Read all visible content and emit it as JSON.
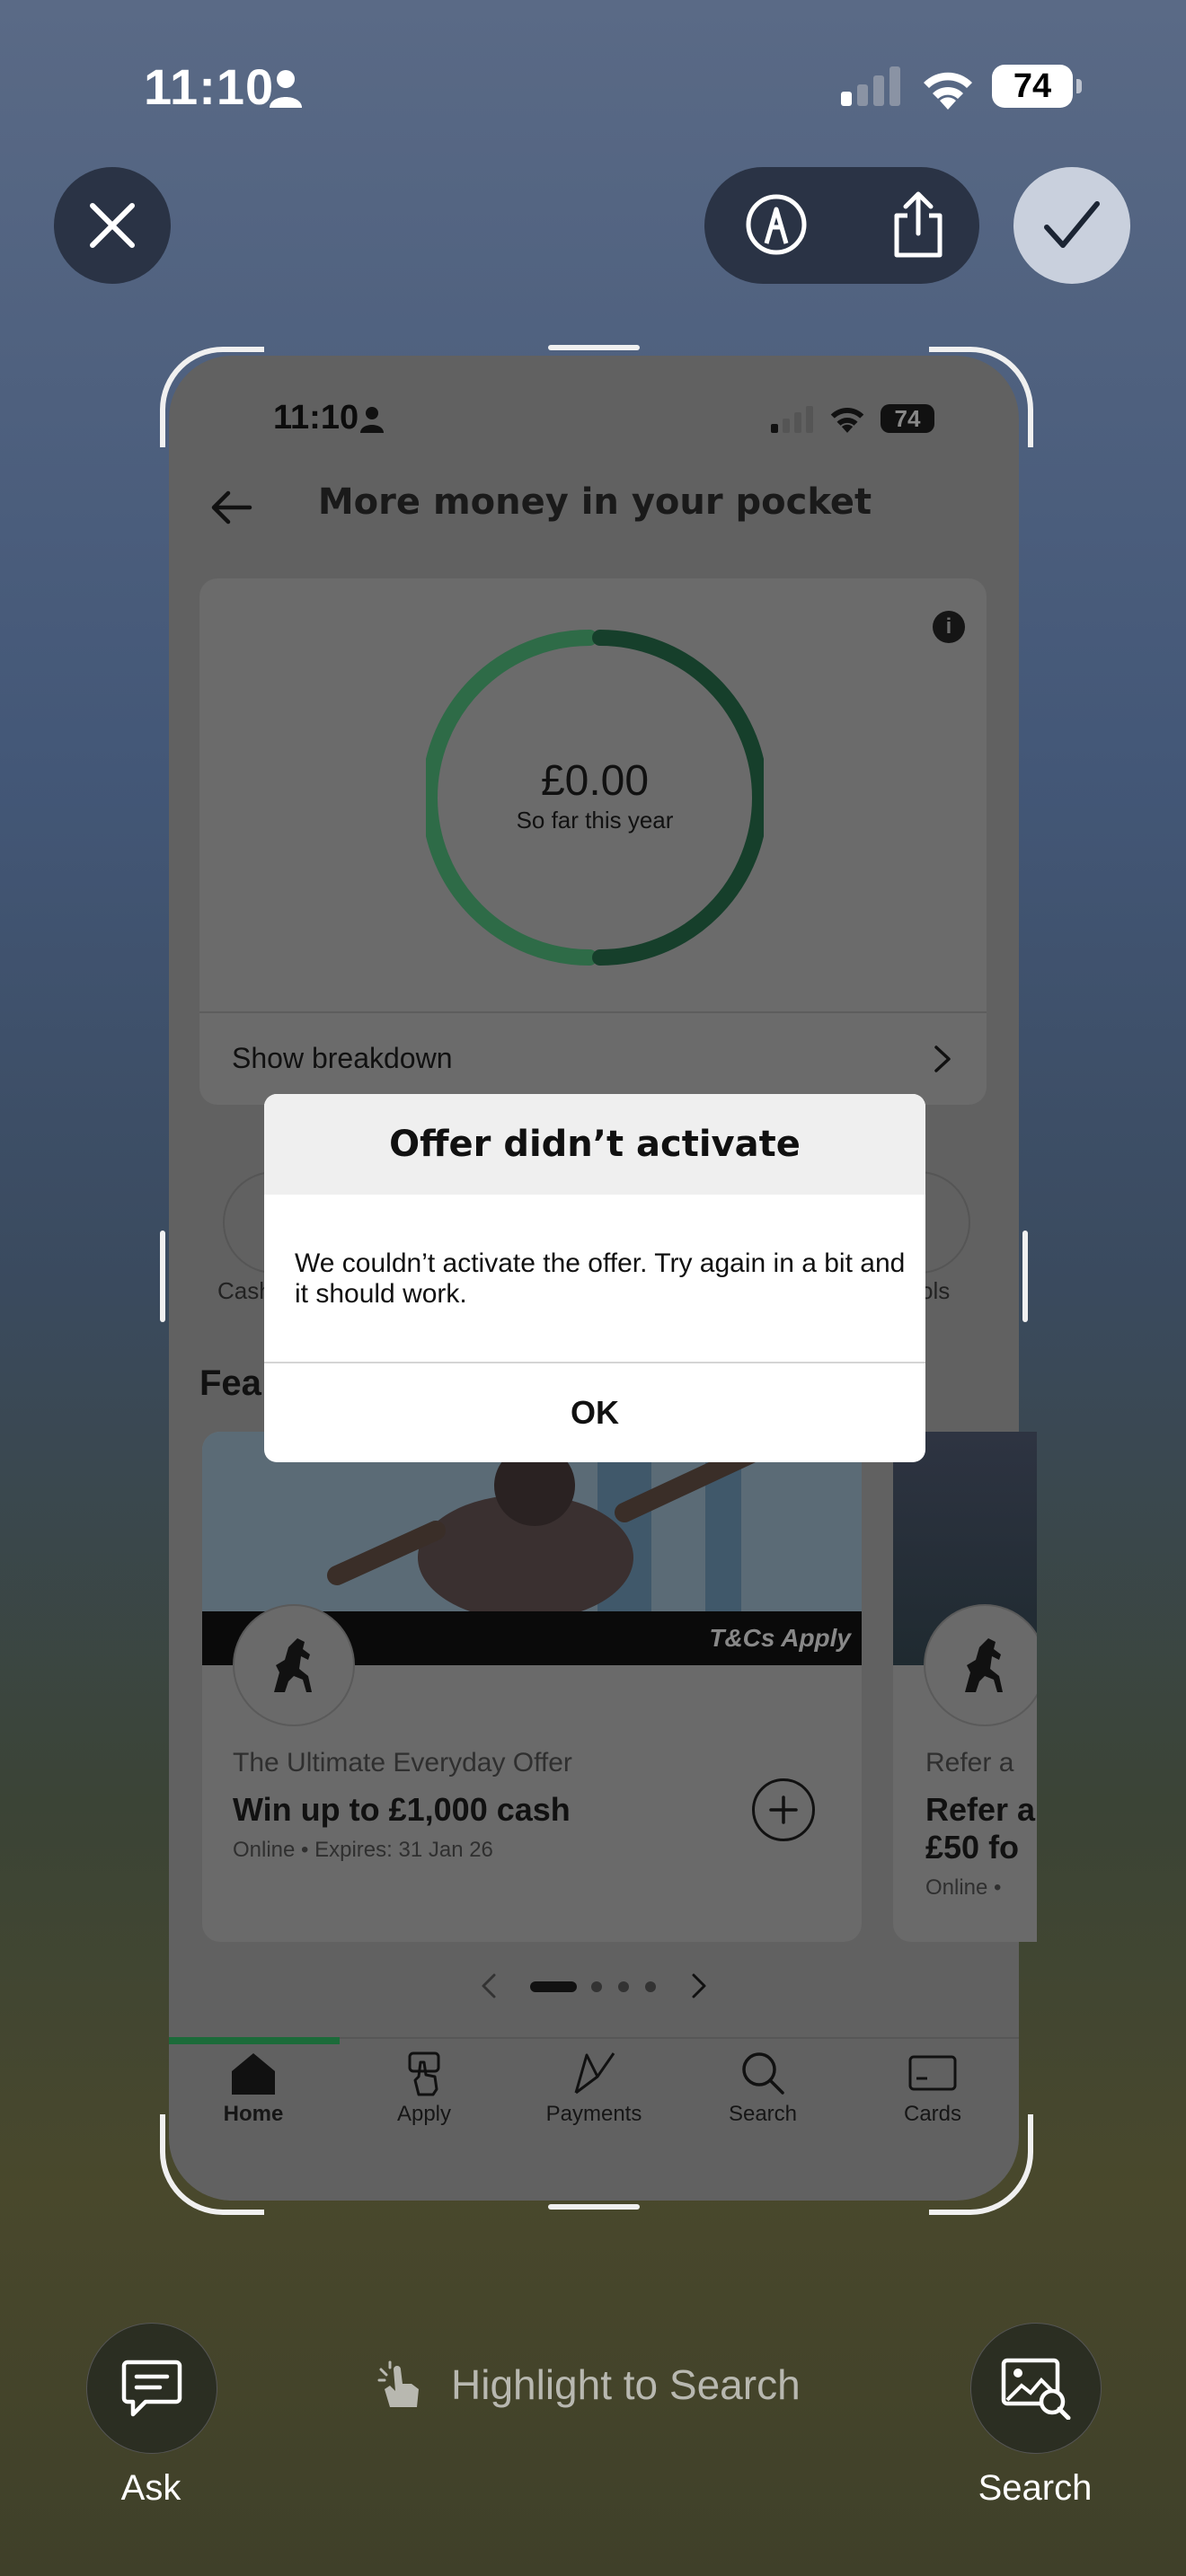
{
  "os_status": {
    "time": "11:10",
    "battery": "74"
  },
  "toolbar": {
    "close": "close",
    "markup": "markup",
    "share": "share",
    "done": "done"
  },
  "screen": {
    "status": {
      "time": "11:10",
      "battery": "74"
    },
    "header": {
      "title": "More money in your pocket"
    },
    "summary": {
      "amount": "£0.00",
      "amount_label": "So far this year",
      "breakdown_label": "Show breakdown",
      "ring_colors": [
        "#2e6b47",
        "#163f2b"
      ]
    },
    "quick_actions": {
      "left_label": "Cash",
      "right_label": "ols"
    },
    "featured_title": "Fea",
    "offers": [
      {
        "tag": "T&Cs Apply",
        "kicker": "The Ultimate Everyday Offer",
        "title": "Win up to £1,000 cash",
        "meta": "Online • Expires: 31 Jan 26"
      },
      {
        "kicker": "Refer a",
        "title_line1": "Refer a",
        "title_line2": "£50 fo",
        "meta": "Online •"
      }
    ],
    "pager": {
      "pages": 4,
      "active": 1
    },
    "tabbar": [
      {
        "label": "Home",
        "active": true
      },
      {
        "label": "Apply"
      },
      {
        "label": "Payments"
      },
      {
        "label": "Search"
      },
      {
        "label": "Cards"
      }
    ],
    "accent_color": "#1c6b3a"
  },
  "dialog": {
    "title": "Offer didn’t activate",
    "message": "We couldn’t activate the offer. Try again in a bit and it should work.",
    "ok_label": "OK"
  },
  "bottom": {
    "ask_label": "Ask",
    "hint": "Highlight to Search",
    "search_label": "Search"
  }
}
